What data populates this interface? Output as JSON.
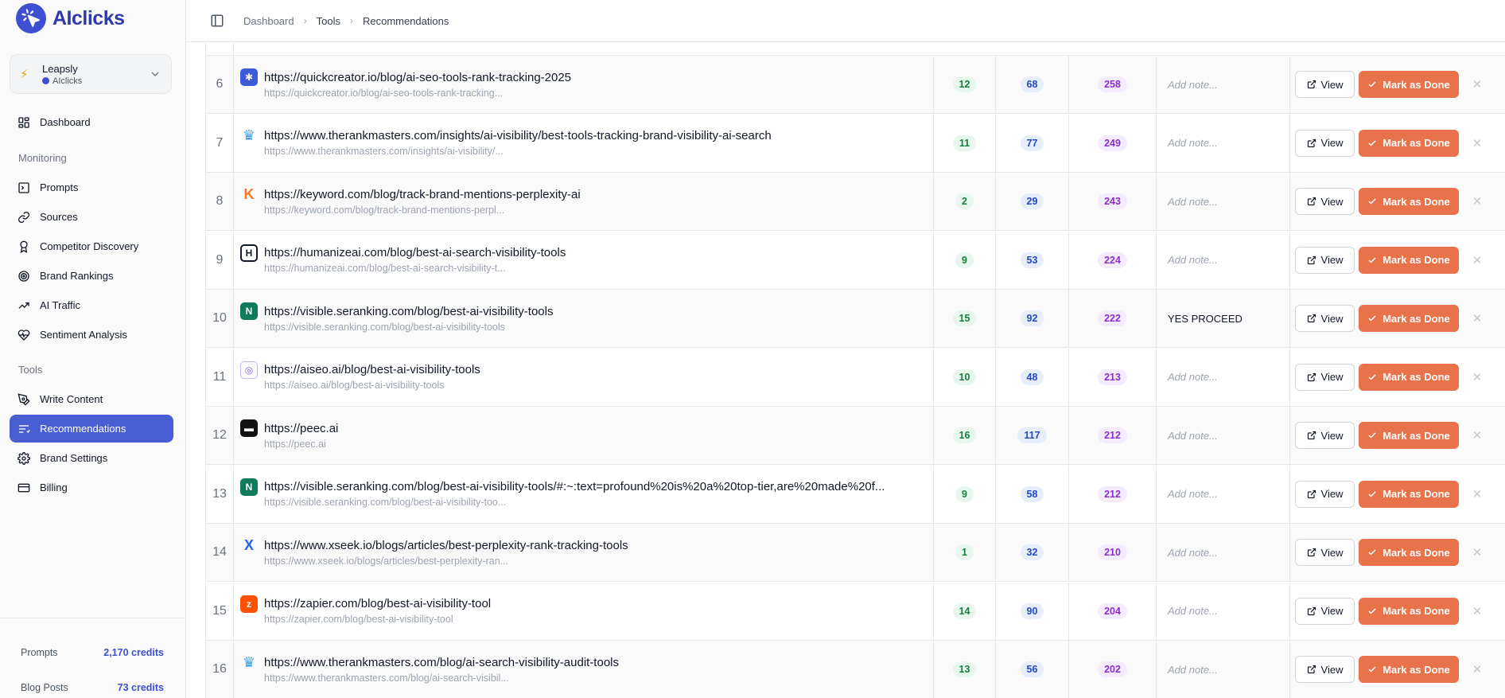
{
  "app": {
    "brand_name": "AIclicks",
    "accent_color": "#4a5ed4",
    "action_color": "#e8724a"
  },
  "workspace": {
    "name": "Leapsly",
    "sub": "AIclicks"
  },
  "breadcrumb": [
    "Dashboard",
    "Tools",
    "Recommendations"
  ],
  "nav": {
    "dashboard": "Dashboard",
    "monitoring_heading": "Monitoring",
    "monitoring": [
      "Prompts",
      "Sources",
      "Competitor Discovery",
      "Brand Rankings",
      "AI Traffic",
      "Sentiment Analysis"
    ],
    "tools_heading": "Tools",
    "tools": [
      "Write Content",
      "Recommendations",
      "Brand Settings",
      "Billing"
    ],
    "active": "Recommendations"
  },
  "credits": [
    {
      "label": "Prompts",
      "value": "2,170 credits"
    },
    {
      "label": "Blog Posts",
      "value": "73 credits"
    }
  ],
  "actions": {
    "view_label": "View",
    "done_label": "Mark as Done",
    "note_placeholder": "Add note..."
  },
  "rows": [
    {
      "num": "6",
      "favicon": "quickcreator-icon",
      "url": "https://quickcreator.io/blog/ai-seo-tools-rank-tracking-2025",
      "sub": "https://quickcreator.io/blog/ai-seo-tools-rank-tracking...",
      "m1": "12",
      "m2": "68",
      "m3": "258",
      "note": ""
    },
    {
      "num": "7",
      "favicon": "crown-icon",
      "url": "https://www.therankmasters.com/insights/ai-visibility/best-tools-tracking-brand-visibility-ai-search",
      "sub": "https://www.therankmasters.com/insights/ai-visibility/...",
      "m1": "11",
      "m2": "77",
      "m3": "249",
      "note": ""
    },
    {
      "num": "8",
      "favicon": "keyword-icon",
      "url": "https://keyword.com/blog/track-brand-mentions-perplexity-ai",
      "sub": "https://keyword.com/blog/track-brand-mentions-perpl...",
      "m1": "2",
      "m2": "29",
      "m3": "243",
      "note": ""
    },
    {
      "num": "9",
      "favicon": "humanize-icon",
      "url": "https://humanizeai.com/blog/best-ai-search-visibility-tools",
      "sub": "https://humanizeai.com/blog/best-ai-search-visibility-t...",
      "m1": "9",
      "m2": "53",
      "m3": "224",
      "note": ""
    },
    {
      "num": "10",
      "favicon": "seranking-icon",
      "url": "https://visible.seranking.com/blog/best-ai-visibility-tools",
      "sub": "https://visible.seranking.com/blog/best-ai-visibility-tools",
      "m1": "15",
      "m2": "92",
      "m3": "222",
      "note": "YES PROCEED"
    },
    {
      "num": "11",
      "favicon": "aiseo-icon",
      "url": "https://aiseo.ai/blog/best-ai-visibility-tools",
      "sub": "https://aiseo.ai/blog/best-ai-visibility-tools",
      "m1": "10",
      "m2": "48",
      "m3": "213",
      "note": ""
    },
    {
      "num": "12",
      "favicon": "peec-icon",
      "url": "https://peec.ai",
      "sub": "https://peec.ai",
      "m1": "16",
      "m2": "117",
      "m3": "212",
      "note": ""
    },
    {
      "num": "13",
      "favicon": "seranking-icon",
      "url": "https://visible.seranking.com/blog/best-ai-visibility-tools/#:~:text=profound%20is%20a%20top-tier,are%20made%20f...",
      "sub": "https://visible.seranking.com/blog/best-ai-visibility-too...",
      "m1": "9",
      "m2": "58",
      "m3": "212",
      "note": ""
    },
    {
      "num": "14",
      "favicon": "xseek-icon",
      "url": "https://www.xseek.io/blogs/articles/best-perplexity-rank-tracking-tools",
      "sub": "https://www.xseek.io/blogs/articles/best-perplexity-ran...",
      "m1": "1",
      "m2": "32",
      "m3": "210",
      "note": ""
    },
    {
      "num": "15",
      "favicon": "zapier-icon",
      "url": "https://zapier.com/blog/best-ai-visibility-tool",
      "sub": "https://zapier.com/blog/best-ai-visibility-tool",
      "m1": "14",
      "m2": "90",
      "m3": "204",
      "note": ""
    },
    {
      "num": "16",
      "favicon": "crown-icon",
      "url": "https://www.therankmasters.com/blog/ai-search-visibility-audit-tools",
      "sub": "https://www.therankmasters.com/blog/ai-search-visibil...",
      "m1": "13",
      "m2": "56",
      "m3": "202",
      "note": ""
    }
  ]
}
